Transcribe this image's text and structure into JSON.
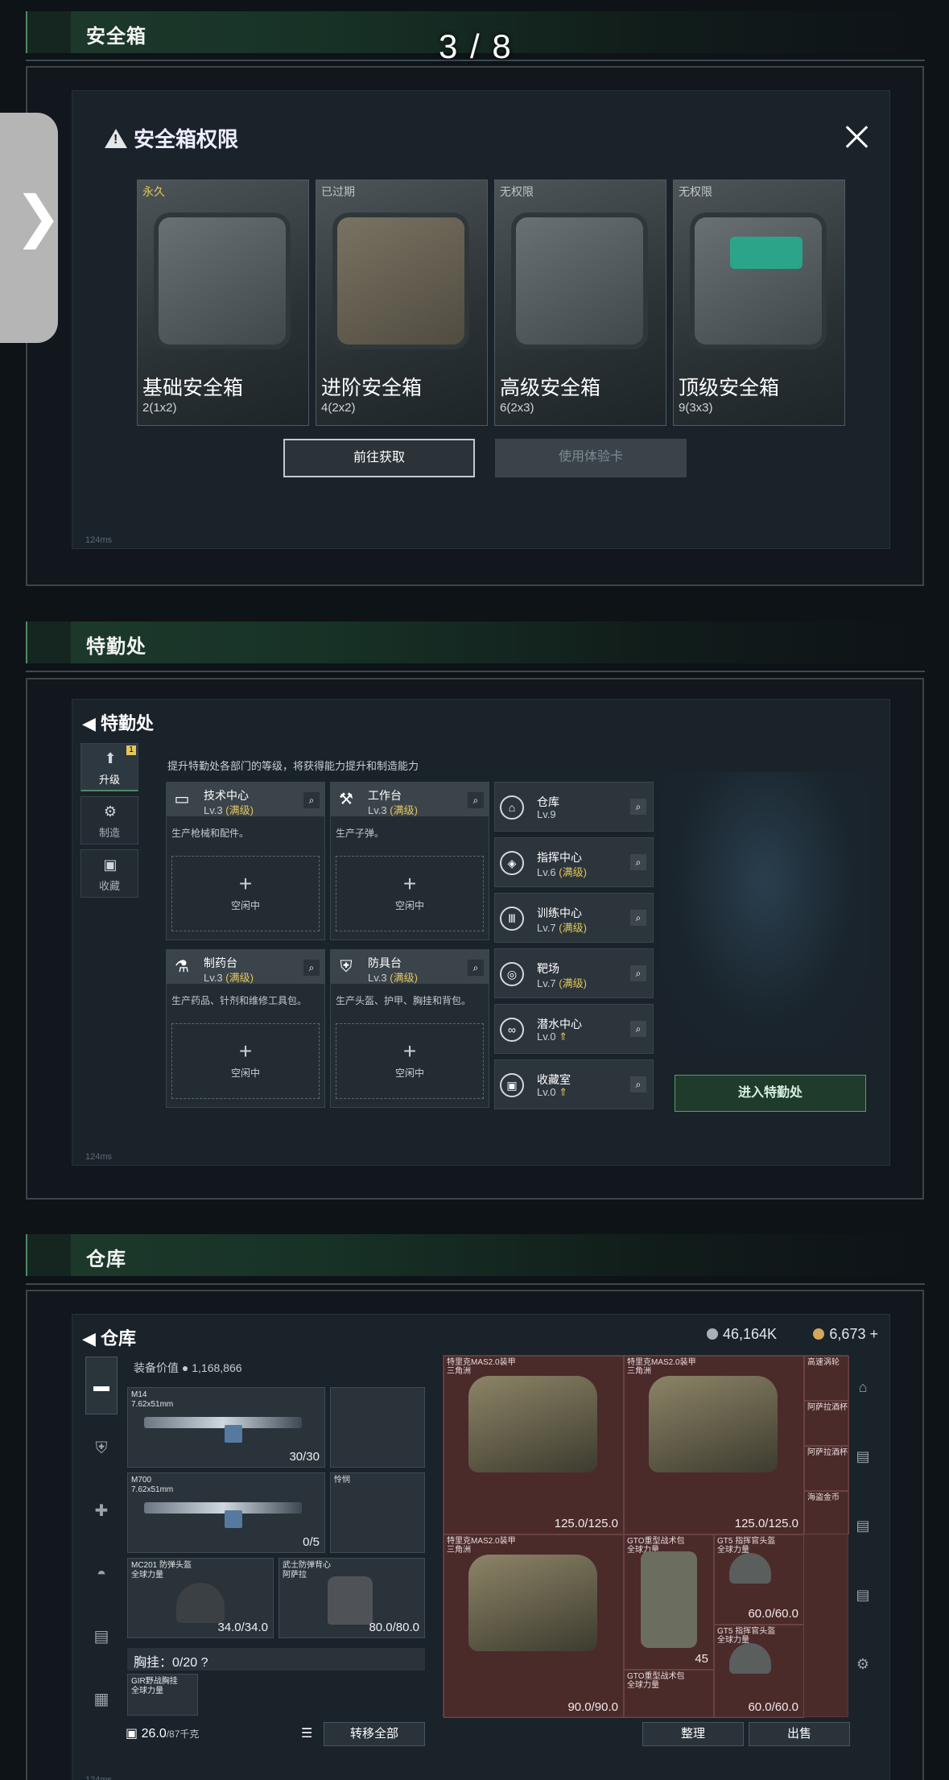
{
  "page_indicator": "3 / 8",
  "side_tab_icon": "chevron-right-icon",
  "section1": {
    "title": "安全箱",
    "dialog": {
      "title": "安全箱权限",
      "status": "124ms",
      "cards": [
        {
          "status": "永久",
          "name": "基础安全箱",
          "size": "2(1x2)"
        },
        {
          "status": "已过期",
          "name": "进阶安全箱",
          "size": "4(2x2)"
        },
        {
          "status": "无权限",
          "name": "高级安全箱",
          "size": "6(2x3)"
        },
        {
          "status": "无权限",
          "name": "顶级安全箱",
          "size": "9(3x3)"
        }
      ],
      "btn_get": "前往获取",
      "btn_trial": "使用体验卡"
    }
  },
  "section2": {
    "title": "特勤处",
    "screen": {
      "title": "特勤处",
      "desc": "提升特勤处各部门的等级，将获得能力提升和制造能力",
      "status": "124ms",
      "side": [
        {
          "label": "升级",
          "badge": "1"
        },
        {
          "label": "制造"
        },
        {
          "label": "收藏"
        }
      ],
      "facilities": [
        {
          "name": "技术中心",
          "lv": "Lv.3",
          "max": "(满级)",
          "desc": "生产枪械和配件。",
          "idle": "空闲中"
        },
        {
          "name": "工作台",
          "lv": "Lv.3",
          "max": "(满级)",
          "desc": "生产子弹。",
          "idle": "空闲中"
        },
        {
          "name": "制药台",
          "lv": "Lv.3",
          "max": "(满级)",
          "desc": "生产药品、针剂和维修工具包。",
          "idle": "空闲中"
        },
        {
          "name": "防具台",
          "lv": "Lv.3",
          "max": "(满级)",
          "desc": "生产头盔、护甲、胸挂和背包。",
          "idle": "空闲中"
        }
      ],
      "rooms": [
        {
          "name": "仓库",
          "lv": "Lv.9",
          "max": ""
        },
        {
          "name": "指挥中心",
          "lv": "Lv.6",
          "max": "(满级)"
        },
        {
          "name": "训练中心",
          "lv": "Lv.7",
          "max": "(满级)"
        },
        {
          "name": "靶场",
          "lv": "Lv.7",
          "max": "(满级)"
        },
        {
          "name": "潜水中心",
          "lv": "Lv.0",
          "max": ""
        },
        {
          "name": "收藏室",
          "lv": "Lv.0",
          "max": ""
        }
      ],
      "enter_btn": "进入特勤处"
    }
  },
  "section3": {
    "title": "仓库",
    "screen": {
      "title": "仓库",
      "currency1": "46,164K",
      "currency2": "6,673",
      "equip_value_label": "装备价值",
      "equip_value": "1,168,866",
      "status": "124ms",
      "loadout": [
        {
          "name": "M14",
          "sub": "7.62x51mm",
          "dur": "30/30"
        },
        {
          "name": "M700",
          "sub": "7.62x51mm",
          "dur": "0/5"
        },
        {
          "name": "怜悯",
          "sub": "",
          "dur": ""
        },
        {
          "name": "MC201 防弹头盔",
          "sub": "全球力量",
          "dur": "34.0/34.0"
        },
        {
          "name": "武士防弹背心",
          "sub": "阿萨拉",
          "dur": "80.0/80.0"
        }
      ],
      "chest_rig": "胸挂：0/20 ?",
      "rig_item": "GIR野战胸挂",
      "rig_item_sub": "全球力量",
      "capacity": "26.0",
      "capacity_max": "/87千克",
      "transfer_all": "转移全部",
      "items": [
        {
          "name": "特里克MAS2.0装甲",
          "sub": "三角洲",
          "dur": "125.0/125.0"
        },
        {
          "name": "特里克MAS2.0装甲",
          "sub": "三角洲",
          "dur": "125.0/125.0"
        },
        {
          "name": "特里克MAS2.0装甲",
          "sub": "三角洲",
          "dur": "90.0/90.0"
        },
        {
          "name": "GTO重型战术包",
          "sub": "全球力量",
          "dur": "45"
        },
        {
          "name": "GT5 指挥官头盔",
          "sub": "全球力量",
          "dur": "60.0/60.0"
        },
        {
          "name": "GT5 指挥官头盔",
          "sub": "全球力量",
          "dur": "60.0/60.0"
        },
        {
          "name": "GTO重型战术包",
          "sub": "全球力量",
          "dur": ""
        }
      ],
      "side_items": [
        "高速涡轮",
        "阿萨拉酒杯",
        "阿萨拉酒杯",
        "海盗金币"
      ],
      "btn_sort": "整理",
      "btn_sell": "出售"
    }
  }
}
